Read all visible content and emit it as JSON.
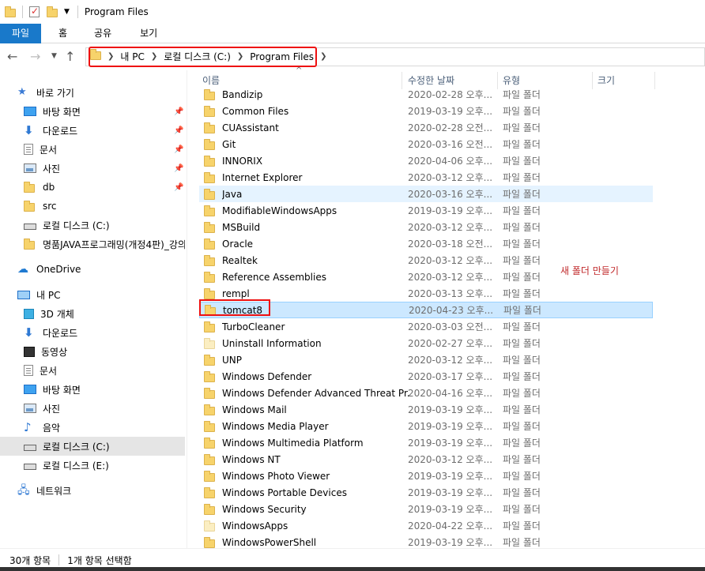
{
  "window": {
    "title": "Program Files"
  },
  "ribbon": {
    "tabs": [
      "파일",
      "홈",
      "공유",
      "보기"
    ]
  },
  "address": {
    "crumbs": [
      "내 PC",
      "로컬 디스크 (C:)",
      "Program Files"
    ]
  },
  "sidebar": {
    "items": [
      {
        "label": "바로 가기",
        "icon": "star-icon",
        "pinned": false
      },
      {
        "label": "바탕 화면",
        "icon": "desktop-icon",
        "pinned": true
      },
      {
        "label": "다운로드",
        "icon": "download-icon",
        "pinned": true
      },
      {
        "label": "문서",
        "icon": "document-icon",
        "pinned": true
      },
      {
        "label": "사진",
        "icon": "picture-icon",
        "pinned": true
      },
      {
        "label": "db",
        "icon": "folder-icon",
        "pinned": true
      },
      {
        "label": "src",
        "icon": "folder-icon",
        "pinned": false
      },
      {
        "label": "로컬 디스크 (C:)",
        "icon": "drive-icon",
        "pinned": false
      },
      {
        "label": "명품JAVA프로그래밍(개정4판)_강의",
        "icon": "folder-icon",
        "pinned": false
      },
      {
        "label": "OneDrive",
        "icon": "cloud-icon",
        "pinned": false
      },
      {
        "label": "내 PC",
        "icon": "pc-icon",
        "pinned": false
      },
      {
        "label": "3D 개체",
        "icon": "cube-icon",
        "pinned": false
      },
      {
        "label": "다운로드",
        "icon": "download-icon",
        "pinned": false
      },
      {
        "label": "동영상",
        "icon": "video-icon",
        "pinned": false
      },
      {
        "label": "문서",
        "icon": "document-icon",
        "pinned": false
      },
      {
        "label": "바탕 화면",
        "icon": "desktop-icon",
        "pinned": false
      },
      {
        "label": "사진",
        "icon": "picture-icon",
        "pinned": false
      },
      {
        "label": "음악",
        "icon": "music-icon",
        "pinned": false
      },
      {
        "label": "로컬 디스크 (C:)",
        "icon": "drive-icon",
        "pinned": false,
        "selected": true
      },
      {
        "label": "로컬 디스크 (E:)",
        "icon": "drive-icon",
        "pinned": false
      },
      {
        "label": "네트워크",
        "icon": "network-icon",
        "pinned": false
      }
    ]
  },
  "columns": {
    "name": "이름",
    "date": "수정한 날짜",
    "type": "유형",
    "size": "크기"
  },
  "files": [
    {
      "name": "Bandizip",
      "date": "2020-02-28 오후...",
      "type": "파일 폴더"
    },
    {
      "name": "Common Files",
      "date": "2019-03-19 오후...",
      "type": "파일 폴더"
    },
    {
      "name": "CUAssistant",
      "date": "2020-02-28 오전...",
      "type": "파일 폴더"
    },
    {
      "name": "Git",
      "date": "2020-03-16 오전...",
      "type": "파일 폴더"
    },
    {
      "name": "INNORIX",
      "date": "2020-04-06 오후...",
      "type": "파일 폴더"
    },
    {
      "name": "Internet Explorer",
      "date": "2020-03-12 오후...",
      "type": "파일 폴더"
    },
    {
      "name": "Java",
      "date": "2020-03-16 오후...",
      "type": "파일 폴더",
      "state": "hover"
    },
    {
      "name": "ModifiableWindowsApps",
      "date": "2019-03-19 오후...",
      "type": "파일 폴더"
    },
    {
      "name": "MSBuild",
      "date": "2020-03-12 오후...",
      "type": "파일 폴더"
    },
    {
      "name": "Oracle",
      "date": "2020-03-18 오전...",
      "type": "파일 폴더"
    },
    {
      "name": "Realtek",
      "date": "2020-03-12 오후...",
      "type": "파일 폴더"
    },
    {
      "name": "Reference Assemblies",
      "date": "2020-03-12 오후...",
      "type": "파일 폴더"
    },
    {
      "name": "rempl",
      "date": "2020-03-13 오후...",
      "type": "파일 폴더"
    },
    {
      "name": "tomcat8",
      "date": "2020-04-23 오후...",
      "type": "파일 폴더",
      "state": "selected"
    },
    {
      "name": "TurboCleaner",
      "date": "2020-03-03 오전...",
      "type": "파일 폴더"
    },
    {
      "name": "Uninstall Information",
      "date": "2020-02-27 오후...",
      "type": "파일 폴더",
      "light": true
    },
    {
      "name": "UNP",
      "date": "2020-03-12 오후...",
      "type": "파일 폴더"
    },
    {
      "name": "Windows Defender",
      "date": "2020-03-17 오후...",
      "type": "파일 폴더"
    },
    {
      "name": "Windows Defender Advanced Threat Pr...",
      "date": "2020-04-16 오후...",
      "type": "파일 폴더"
    },
    {
      "name": "Windows Mail",
      "date": "2019-03-19 오후...",
      "type": "파일 폴더"
    },
    {
      "name": "Windows Media Player",
      "date": "2019-03-19 오후...",
      "type": "파일 폴더"
    },
    {
      "name": "Windows Multimedia Platform",
      "date": "2019-03-19 오후...",
      "type": "파일 폴더"
    },
    {
      "name": "Windows NT",
      "date": "2020-03-12 오후...",
      "type": "파일 폴더"
    },
    {
      "name": "Windows Photo Viewer",
      "date": "2019-03-19 오후...",
      "type": "파일 폴더"
    },
    {
      "name": "Windows Portable Devices",
      "date": "2019-03-19 오후...",
      "type": "파일 폴더"
    },
    {
      "name": "Windows Security",
      "date": "2019-03-19 오후...",
      "type": "파일 폴더"
    },
    {
      "name": "WindowsApps",
      "date": "2020-04-22 오후...",
      "type": "파일 폴더",
      "light": true
    },
    {
      "name": "WindowsPowerShell",
      "date": "2019-03-19 오후...",
      "type": "파일 폴더"
    }
  ],
  "annotation": {
    "text": "새 폴더 만들기"
  },
  "status": {
    "count": "30개 항목",
    "selection": "1개 항목 선택함"
  },
  "colors": {
    "accent": "#1979ca",
    "highlight": "#e11111",
    "selected_row": "#cce8ff",
    "hover_row": "#e5f3ff"
  }
}
